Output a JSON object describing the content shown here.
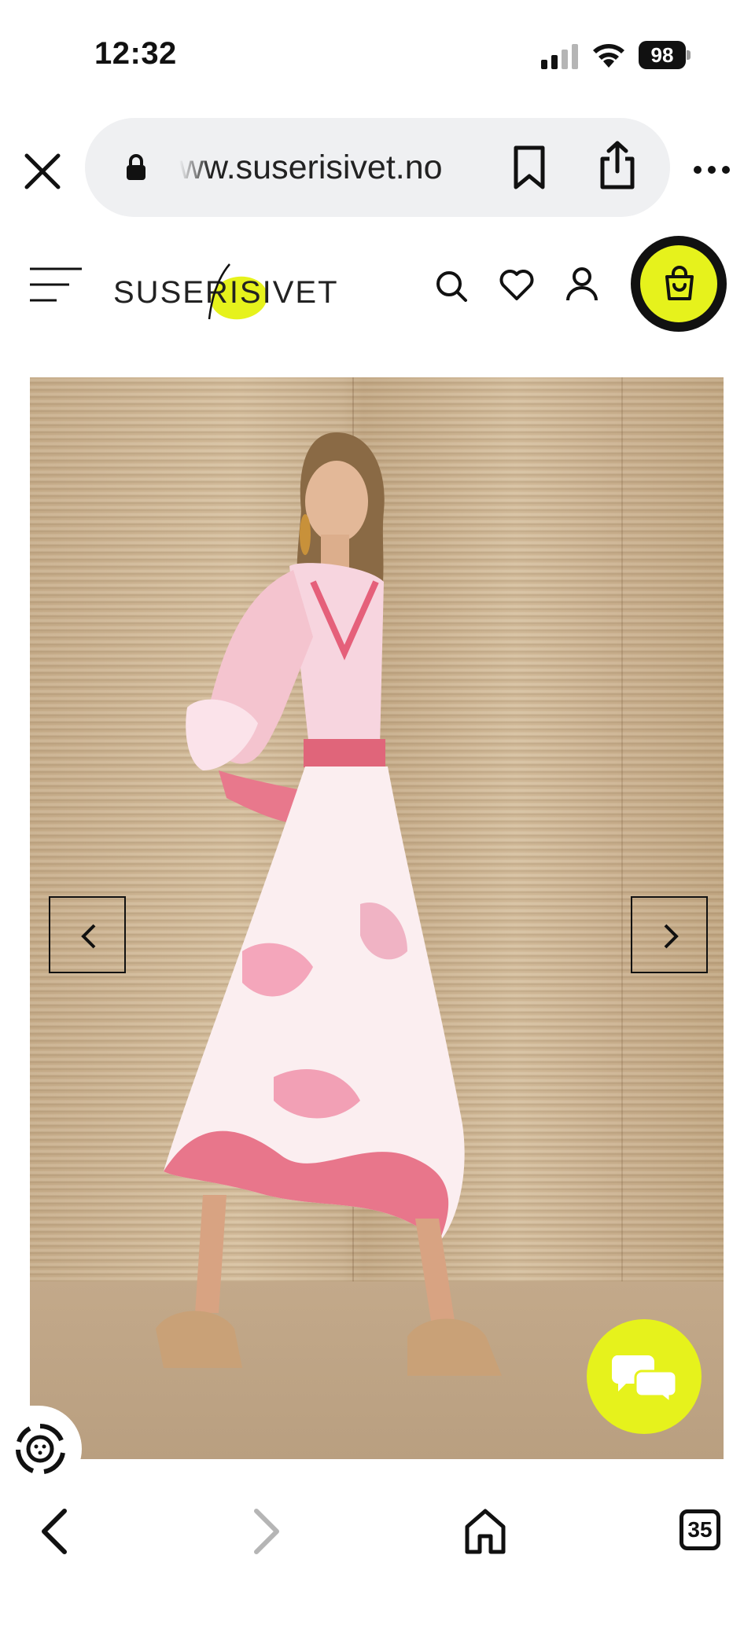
{
  "status_bar": {
    "time": "12:32",
    "battery": "98"
  },
  "browser": {
    "url": "ww.suserisivet.no",
    "tab_count": "35"
  },
  "site": {
    "logo_text": "SUSERISIVET",
    "brand_color": "#e6f21c"
  },
  "icons": {
    "close": "close-icon",
    "lock": "lock-icon",
    "bookmark": "bookmark-icon",
    "share": "share-icon",
    "more": "more-icon",
    "menu": "hamburger-menu-icon",
    "search": "search-icon",
    "wishlist": "heart-icon",
    "account": "user-icon",
    "cart": "shopping-bag-icon",
    "prev": "chevron-left-icon",
    "next": "chevron-right-icon",
    "chat": "chat-bubbles-icon",
    "accessibility": "accessibility-icon",
    "back": "back-arrow-icon",
    "forward": "forward-arrow-icon",
    "home": "home-icon"
  }
}
